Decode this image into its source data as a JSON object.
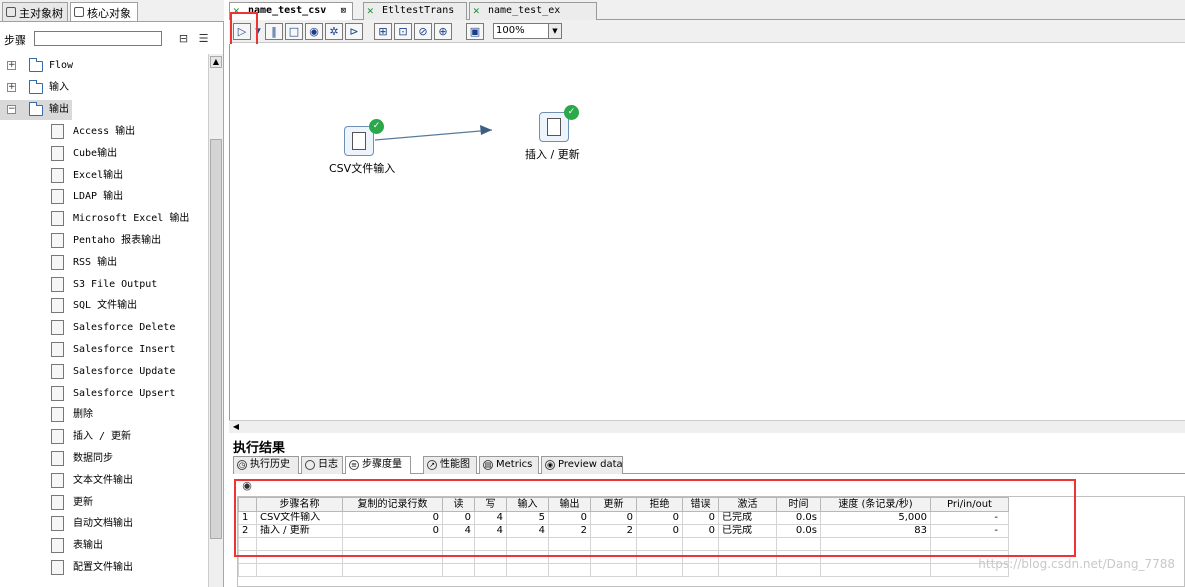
{
  "left_panel": {
    "tabs": [
      {
        "label": "主对象树"
      },
      {
        "label": "核心对象"
      }
    ],
    "steps_label": "步骤",
    "steps_search_value": "",
    "tree": {
      "folders": [
        {
          "label": "Flow"
        },
        {
          "label": "输入"
        },
        {
          "label": "输出"
        }
      ],
      "output_items": [
        "Access 输出",
        "Cube输出",
        "Excel输出",
        "LDAP 输出",
        "Microsoft Excel 输出",
        "Pentaho 报表输出",
        "RSS 输出",
        "S3 File Output",
        "SQL 文件输出",
        "Salesforce Delete",
        "Salesforce Insert",
        "Salesforce Update",
        "Salesforce Upsert",
        "删除",
        "插入 / 更新",
        "数据同步",
        "文本文件输出",
        "更新",
        "自动文档输出",
        "表输出",
        "配置文件输出"
      ]
    }
  },
  "editor": {
    "tabs": [
      {
        "label": "name_test_csv",
        "active": true
      },
      {
        "label": "EtltestTrans",
        "active": false
      },
      {
        "label": "name_test_ex",
        "active": false
      }
    ],
    "zoom": "100%",
    "steps": [
      {
        "label": "CSV文件输入",
        "status": "ok"
      },
      {
        "label": "插入 / 更新",
        "status": "ok"
      }
    ]
  },
  "results": {
    "title": "执行结果",
    "tabs": [
      {
        "label": "执行历史"
      },
      {
        "label": "日志"
      },
      {
        "label": "步骤度量"
      },
      {
        "label": "性能图"
      },
      {
        "label": "Metrics"
      },
      {
        "label": "Preview data"
      }
    ],
    "columns": [
      "",
      "步骤名称",
      "复制的记录行数",
      "读",
      "写",
      "输入",
      "输出",
      "更新",
      "拒绝",
      "错误",
      "激活",
      "时间",
      "速度 (条记录/秒)",
      "Pri/in/out"
    ],
    "rows": [
      [
        "1",
        "CSV文件输入",
        "0",
        "0",
        "4",
        "5",
        "0",
        "0",
        "0",
        "0",
        "已完成",
        "0.0s",
        "5,000",
        "-"
      ],
      [
        "2",
        "插入 / 更新",
        "0",
        "4",
        "4",
        "4",
        "2",
        "2",
        "0",
        "0",
        "已完成",
        "0.0s",
        "83",
        "-"
      ]
    ]
  },
  "watermark": "https://blog.csdn.net/Dang_7788"
}
